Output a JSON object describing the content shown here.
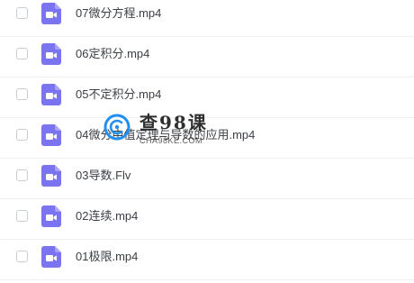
{
  "colors": {
    "accent": "#7b74f0",
    "text": "#3b3f45",
    "divider": "#eef0f4"
  },
  "files": [
    {
      "name": "07微分方程.mp4",
      "icon": "video-file-icon"
    },
    {
      "name": "06定积分.mp4",
      "icon": "video-file-icon"
    },
    {
      "name": "05不定积分.mp4",
      "icon": "video-file-icon"
    },
    {
      "name": "04微分中值定理与导数的应用.mp4",
      "icon": "video-file-icon"
    },
    {
      "name": "03导数.Flv",
      "icon": "video-file-icon"
    },
    {
      "name": "02连续.mp4",
      "icon": "video-file-icon"
    },
    {
      "name": "01极限.mp4",
      "icon": "video-file-icon"
    }
  ],
  "watermark": {
    "title": "查98课",
    "subtitle": "CHA98KE.COM"
  }
}
